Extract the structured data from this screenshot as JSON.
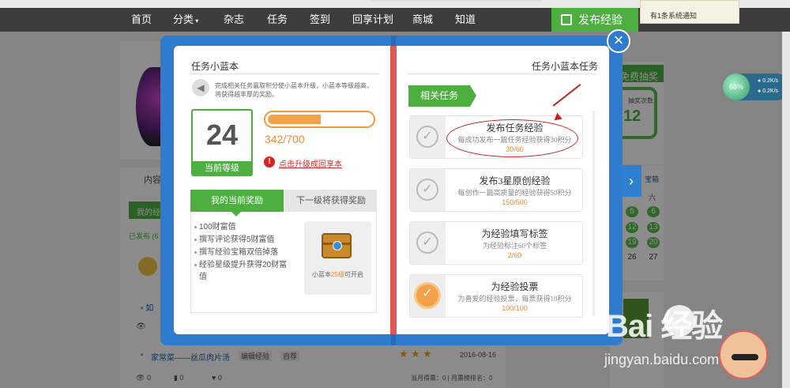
{
  "nav": {
    "items": [
      "首页",
      "分类",
      "杂志",
      "任务",
      "签到",
      "回享计划",
      "商城",
      "知道"
    ],
    "publish": "发布经验",
    "notification": "有1条系统通知"
  },
  "background": {
    "right_title": "免费抽奖",
    "ring_text": "抽奖次数",
    "ring_num": "12",
    "calendar_week": "六",
    "calendar_tab": "宝箱",
    "calendar": [
      [
        "5",
        "6"
      ],
      [
        "12",
        "13"
      ],
      [
        "19",
        "20"
      ],
      [
        "26",
        "27"
      ]
    ],
    "content_tab": "内容",
    "my_tab": "我的经",
    "published": "已发布 (6",
    "list_item_prefix": "如",
    "list_item": {
      "title": "家常菜——丝瓜肉片汤",
      "edit": "编辑经验",
      "tag": "自荐",
      "date": "2016-08-16",
      "views": "0",
      "votes": "0",
      "likes": "0",
      "footer": "当月得票：0 | 月票榜排名：0"
    },
    "speed": {
      "ball": "68%",
      "up": "0.2K/s",
      "down": "0.2K/s"
    }
  },
  "modal": {
    "left": {
      "title": "任务小蓝本",
      "intro": "完成相关任务赢取积分使小蓝本升级，小蓝本等级越高，将获得越丰厚的奖励。",
      "level": "24",
      "level_label": "当前等级",
      "progress": 0.49,
      "xp": "342/700",
      "upgrade_link": "点击升级成回享本",
      "tab_current": "我的当前奖励",
      "tab_next": "下一级将获得奖励",
      "rewards": [
        "100财富值",
        "撰写评论获得5财富值",
        "撰写经验宝箱双倍掉落",
        "经验星级提升获得20财富值"
      ],
      "chest_prefix": "小蓝本",
      "chest_level": "25级",
      "chest_suffix": "可开启"
    },
    "right": {
      "title": "任务小蓝本任务",
      "ribbon": "相关任务",
      "tasks": [
        {
          "name": "发布任务经验",
          "desc": "每成功发布一篇任务经验获得30积分",
          "progress": "30/60",
          "done": false
        },
        {
          "name": "发布3星原创经验",
          "desc": "每创作一篇高质量的经验获得50积分",
          "progress": "150/500",
          "done": false
        },
        {
          "name": "为经验填写标签",
          "desc": "为经验标注60个标签",
          "progress": "2/60",
          "done": false
        },
        {
          "name": "为经验投票",
          "desc": "为喜爱的经验投票，每票获得10积分",
          "progress": "100/100",
          "done": true
        }
      ]
    }
  },
  "watermark": {
    "brand": "Bai  经验",
    "url": "jingyan.baidu.com"
  }
}
